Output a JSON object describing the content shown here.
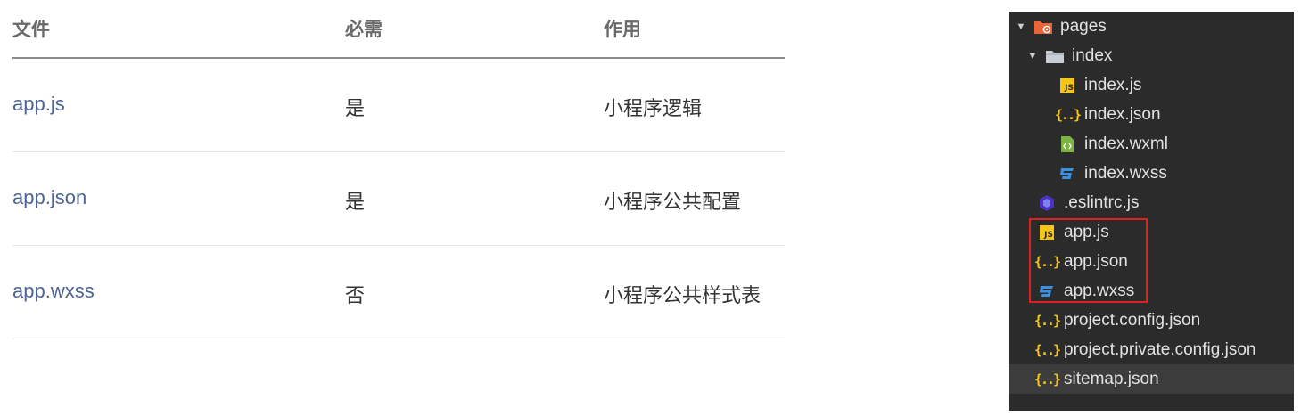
{
  "table": {
    "headers": {
      "file": "文件",
      "required": "必需",
      "purpose": "作用"
    },
    "rows": [
      {
        "file": "app.js",
        "required": "是",
        "purpose": "小程序逻辑"
      },
      {
        "file": "app.json",
        "required": "是",
        "purpose": "小程序公共配置"
      },
      {
        "file": "app.wxss",
        "required": "否",
        "purpose": "小程序公共样式表"
      }
    ]
  },
  "tree": {
    "items": [
      {
        "label": "pages",
        "icon": "pages-folder-icon",
        "expanded": true
      },
      {
        "label": "index",
        "icon": "folder-icon",
        "expanded": true
      },
      {
        "label": "index.js",
        "icon": "js-file-icon"
      },
      {
        "label": "index.json",
        "icon": "json-file-icon"
      },
      {
        "label": "index.wxml",
        "icon": "wxml-file-icon"
      },
      {
        "label": "index.wxss",
        "icon": "wxss-file-icon"
      },
      {
        "label": ".eslintrc.js",
        "icon": "eslint-file-icon"
      },
      {
        "label": "app.js",
        "icon": "js-file-icon"
      },
      {
        "label": "app.json",
        "icon": "json-file-icon"
      },
      {
        "label": "app.wxss",
        "icon": "wxss-file-icon"
      },
      {
        "label": "project.config.json",
        "icon": "json-file-icon"
      },
      {
        "label": "project.private.config.json",
        "icon": "json-file-icon"
      },
      {
        "label": "sitemap.json",
        "icon": "json-file-icon",
        "selected": true
      }
    ]
  },
  "colors": {
    "tree_bg": "#2b2b2b",
    "selected_bg": "#3c3c3c",
    "highlight": "#e02020",
    "link": "#4d6494",
    "js_badge": "#f5c518",
    "wxss": "#3d8fe0",
    "wxml": "#7cb342",
    "pages_folder": "#e8653a"
  }
}
